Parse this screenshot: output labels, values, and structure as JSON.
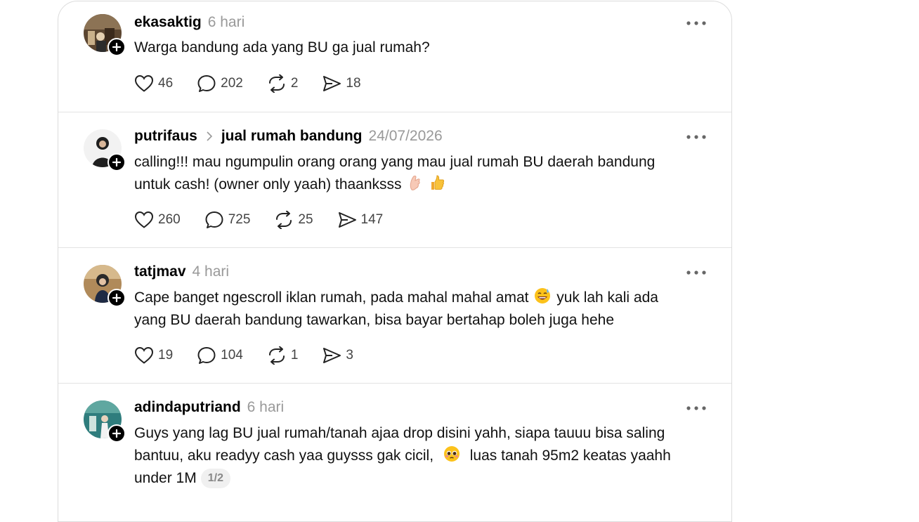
{
  "posts": [
    {
      "username": "ekasaktig",
      "time": "6 hari",
      "text": "Warga bandung ada yang BU ga jual rumah?",
      "likes": "46",
      "replies": "202",
      "reposts": "2",
      "shares": "18",
      "avatar_color": "#7a5a3a"
    },
    {
      "username": "putrifaus",
      "community": "jual rumah bandung",
      "time": "24/07/2026",
      "text_line1": "calling!!! mau ngumpulin orang orang yang mau jual rumah BU daerah bandung",
      "text_line2": "untuk cash! (owner only yaah) thaanksss",
      "emojis": [
        "pinched-fingers-icon",
        "thumbs-up-icon"
      ],
      "likes": "260",
      "replies": "725",
      "reposts": "25",
      "shares": "147",
      "avatar_color": "#e8e8e8"
    },
    {
      "username": "tatjmav",
      "time": "4 hari",
      "text_part1": "Cape banget ngescroll iklan rumah, pada mahal mahal amat",
      "text_part2": "yuk lah kali ada",
      "text_line2": "yang BU daerah bandung tawarkan, bisa bayar bertahap boleh juga hehe",
      "emojis": [
        "grinning-sweat-icon"
      ],
      "likes": "19",
      "replies": "104",
      "reposts": "1",
      "shares": "3",
      "avatar_color": "#8a6a48"
    },
    {
      "username": "adindaputriand",
      "time": "6 hari",
      "text_line1": "Guys yang lag BU jual rumah/tanah ajaa drop disini yahh, siapa tauuu bisa saling",
      "text_part1": "bantuu, aku readyy cash yaa guysss gak cicil,",
      "text_part2": "luas tanah 95m2 keatas yaahh",
      "text_line3": "under 1M",
      "pager": "1/2",
      "emojis": [
        "pleading-face-icon"
      ],
      "avatar_color": "#3a8a8a"
    }
  ]
}
